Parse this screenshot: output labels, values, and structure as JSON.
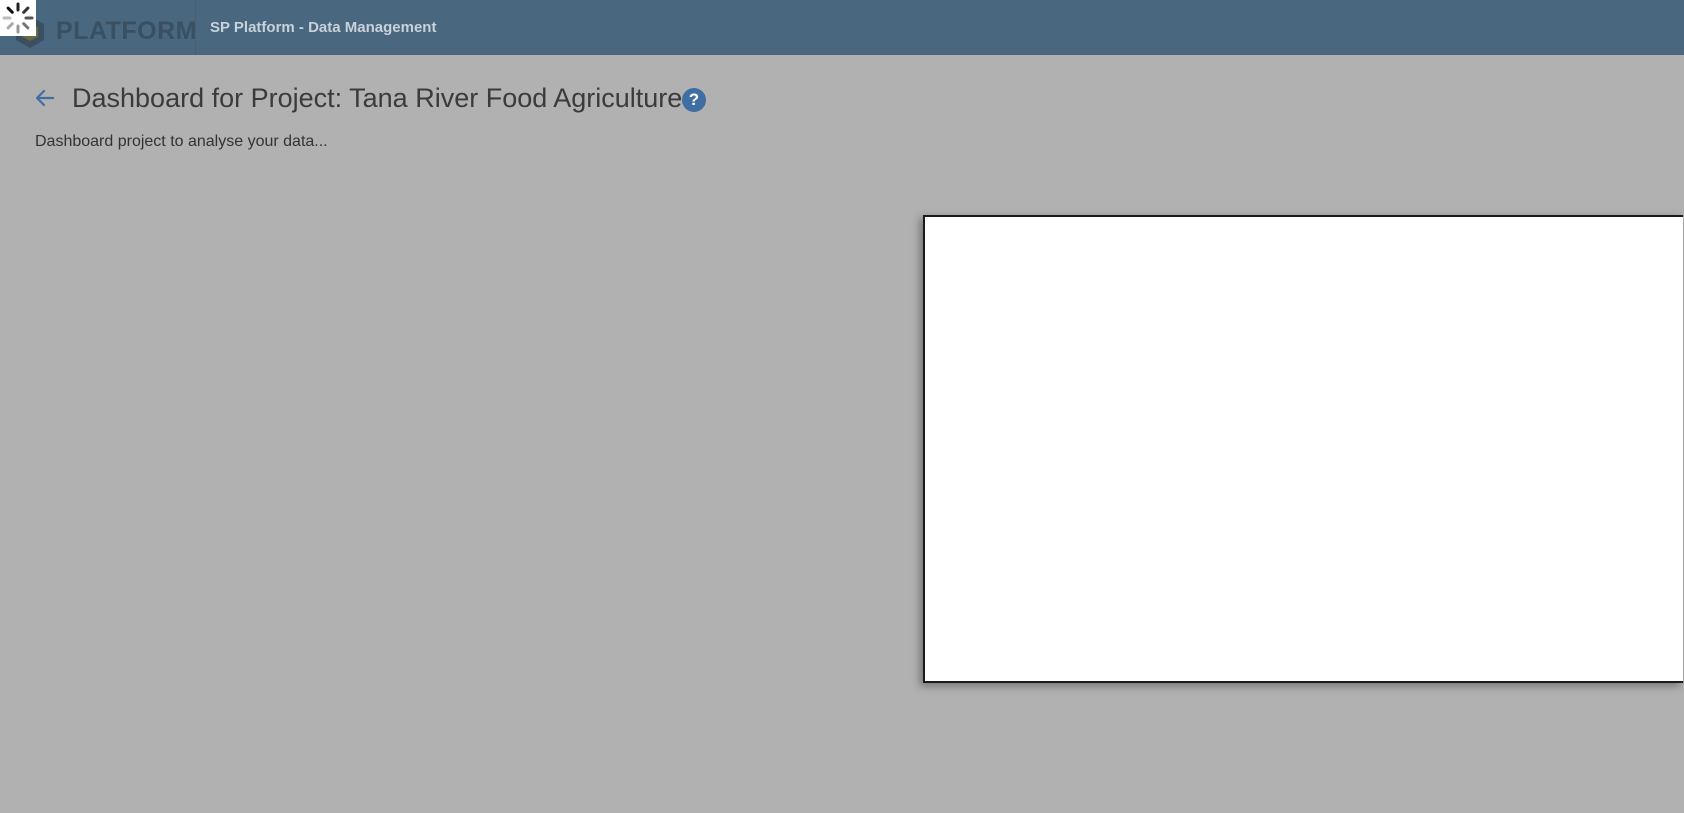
{
  "header": {
    "logo_text": "PLATFORM",
    "app_title": "SP Platform - Data Management",
    "background_color": "#4a6780"
  },
  "page": {
    "title": "Dashboard for Project: Tana River Food Agriculture",
    "subtitle": "Dashboard project to analyse your data...",
    "help_icon_glyph": "?",
    "overlay_color": "#b1b1b1"
  },
  "icons": {
    "back": "arrow-left-icon",
    "help": "question-circle-icon",
    "logo": "hexagon-logo-icon",
    "loading": "loading-spinner-icon"
  },
  "dialog": {
    "state": "loading"
  }
}
